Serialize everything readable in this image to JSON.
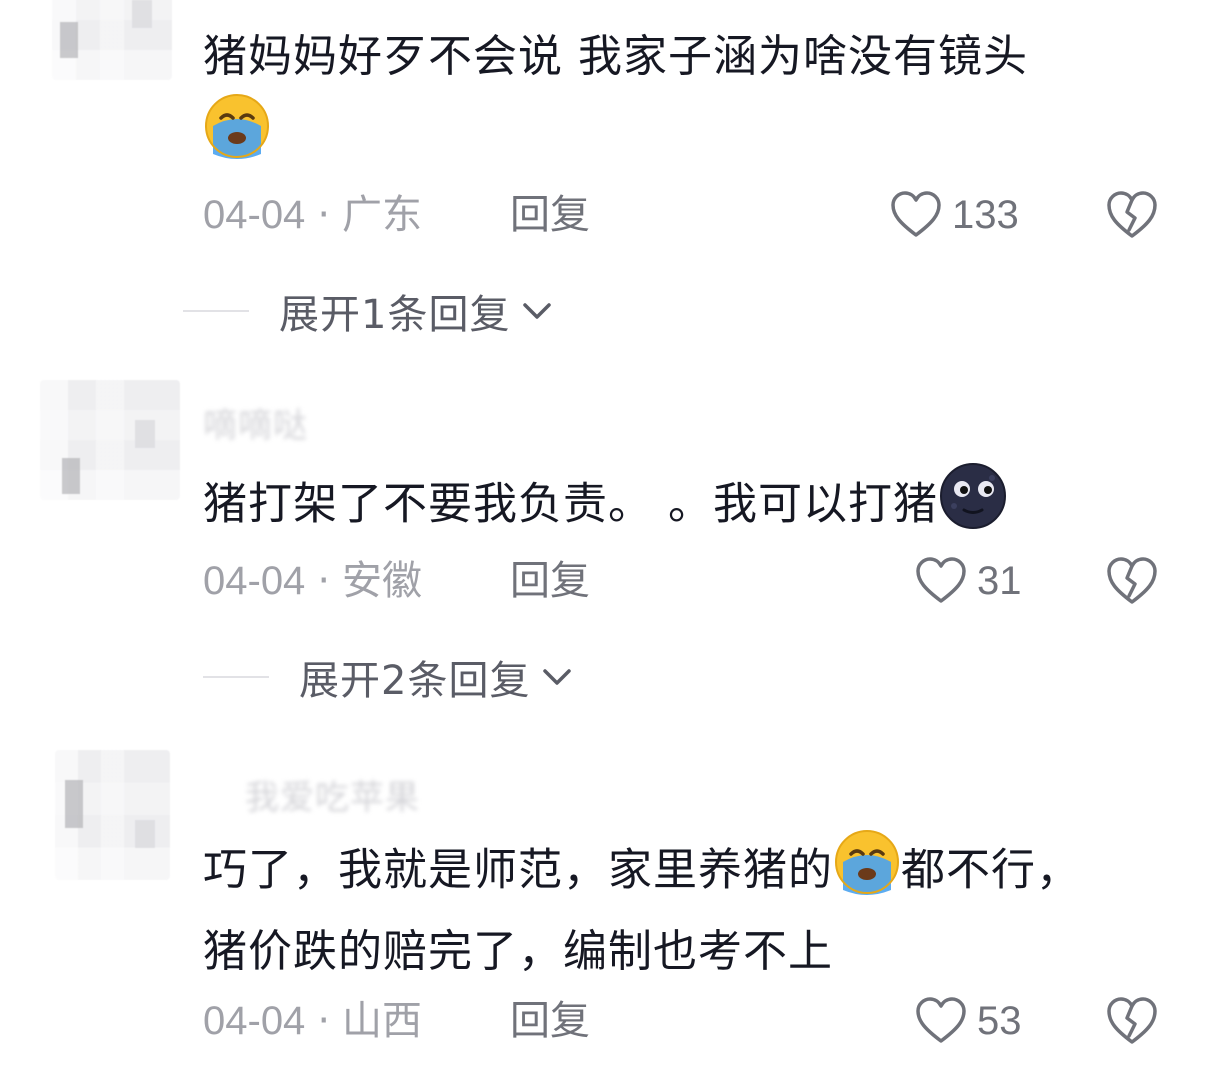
{
  "comments": [
    {
      "text": "猪妈妈好歹不会说 我家子涵为啥没有镜头",
      "emoji": "loudly-crying-face",
      "date": "04-04",
      "location": "广东",
      "reply_label": "回复",
      "likes": "133",
      "expand_label": "展开1条回复"
    },
    {
      "username": "嘀嘀哒",
      "text": "猪打架了不要我负责。 。我可以打猪",
      "emoji": "new-moon-face",
      "date": "04-04",
      "location": "安徽",
      "reply_label": "回复",
      "likes": "31",
      "expand_label": "展开2条回复"
    },
    {
      "username": "我爱吃苹果",
      "text_before_emoji": "巧了，我就是师范，家里养猪的",
      "emoji": "loudly-crying-face",
      "text_after_emoji": "都不行，猪价跌的赔完了，编制也考不上",
      "date": "04-04",
      "location": "山西",
      "reply_label": "回复",
      "likes": "53"
    }
  ],
  "separator": "·",
  "colors": {
    "text": "#161823",
    "meta": "#a0a1a8",
    "action": "#70727a",
    "crying_face_yellow": "#f9c22e",
    "tears_blue": "#4aa3f0",
    "moon_dark": "#2a2d45"
  }
}
